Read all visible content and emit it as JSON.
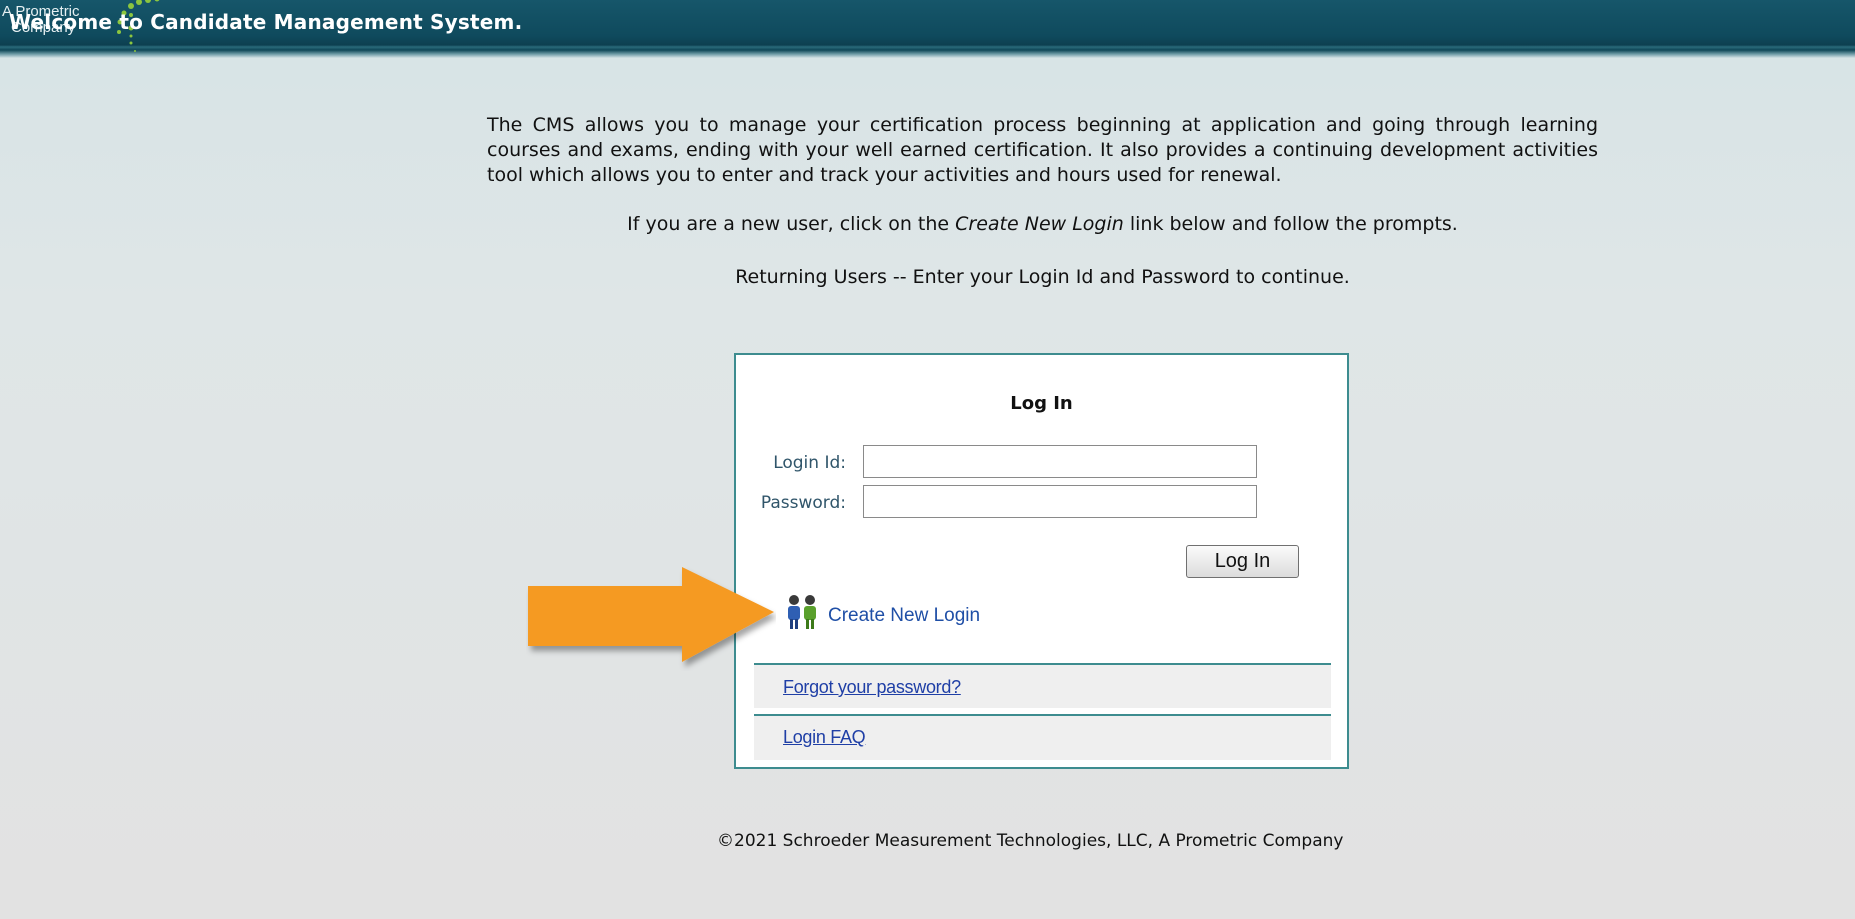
{
  "header": {
    "logo_line1": "A Prometric",
    "logo_line2": "Company",
    "title": "Welcome to Candidate Management System.",
    "bg_color": "#0f4a5d"
  },
  "intro": {
    "paragraph": "The CMS allows you to manage your certification process beginning at application and going through learning courses and exams, ending with your well earned certification. It also provides a continuing development activities tool which allows you to enter and track your activities and hours used for renewal.",
    "new_user_prefix": "If you are a new user, click on the ",
    "new_user_link_text": "Create New Login",
    "new_user_suffix": " link below and follow the prompts.",
    "returning_users": "Returning Users -- Enter your Login Id and Password to continue."
  },
  "login": {
    "title": "Log In",
    "login_id_label": "Login Id:",
    "login_id_value": "",
    "password_label": "Password:",
    "password_value": "",
    "submit_label": "Log In",
    "create_new_login": "Create New Login",
    "forgot_password": "Forgot your password?",
    "login_faq": "Login FAQ",
    "icons": [
      "users-icon"
    ],
    "border_color": "#3d8c8f"
  },
  "annotation": {
    "arrow_color": "#f59a23",
    "icon": "arrow-right-icon"
  },
  "footer": {
    "copyright": "©2021 Schroeder Measurement Technologies, LLC, A Prometric Company"
  }
}
